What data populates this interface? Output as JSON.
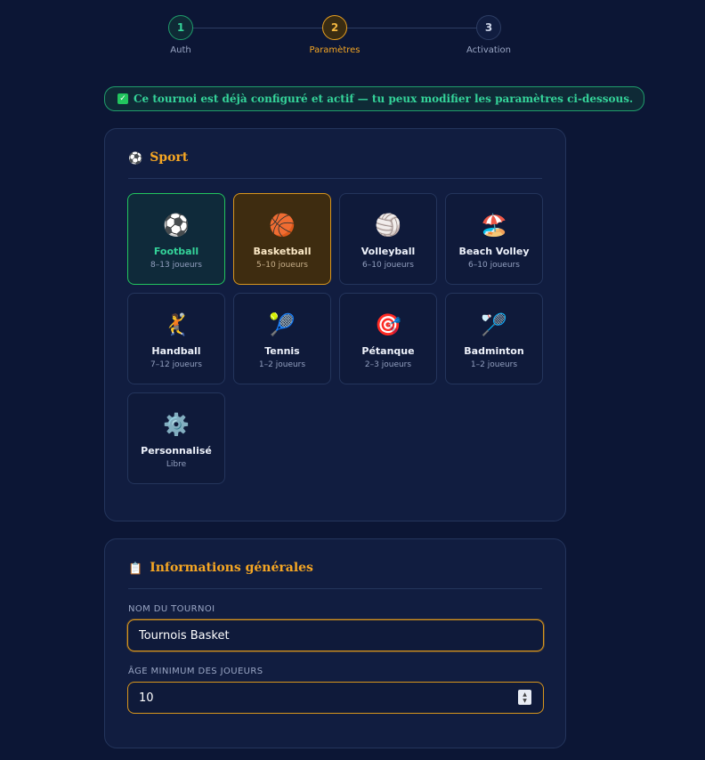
{
  "stepper": {
    "steps": [
      {
        "number": "1",
        "label": "Auth",
        "state": "done"
      },
      {
        "number": "2",
        "label": "Paramètres",
        "state": "active"
      },
      {
        "number": "3",
        "label": "Activation",
        "state": "pending"
      }
    ]
  },
  "banner": {
    "icon": "check-icon",
    "text": "Ce tournoi est déjà configuré et actif — tu peux modifier les paramètres ci-dessous."
  },
  "sport_section": {
    "icon": "⚽",
    "title": "Sport",
    "sports": [
      {
        "emoji": "⚽",
        "name": "Football",
        "players": "8–13 joueurs",
        "state": "selected-green"
      },
      {
        "emoji": "🏀",
        "name": "Basketball",
        "players": "5–10 joueurs",
        "state": "selected-orange"
      },
      {
        "emoji": "🏐",
        "name": "Volleyball",
        "players": "6–10 joueurs",
        "state": ""
      },
      {
        "emoji": "🏖️",
        "name": "Beach Volley",
        "players": "6–10 joueurs",
        "state": ""
      },
      {
        "emoji": "🤾",
        "name": "Handball",
        "players": "7–12 joueurs",
        "state": ""
      },
      {
        "emoji": "🎾",
        "name": "Tennis",
        "players": "1–2 joueurs",
        "state": ""
      },
      {
        "emoji": "🎯",
        "name": "Pétanque",
        "players": "2–3 joueurs",
        "state": ""
      },
      {
        "emoji": "🏸",
        "name": "Badminton",
        "players": "1–2 joueurs",
        "state": ""
      },
      {
        "emoji": "⚙️",
        "name": "Personnalisé",
        "players": "Libre",
        "state": ""
      }
    ]
  },
  "info_section": {
    "icon": "📋",
    "title": "Informations générales",
    "name_label": "NOM DU TOURNOI",
    "name_value": "Tournois Basket",
    "age_label": "ÂGE MINIMUM DES JOUEURS",
    "age_value": "10"
  },
  "colors": {
    "background": "#0c1635",
    "accent": "#f5a623",
    "success": "#34d399"
  }
}
